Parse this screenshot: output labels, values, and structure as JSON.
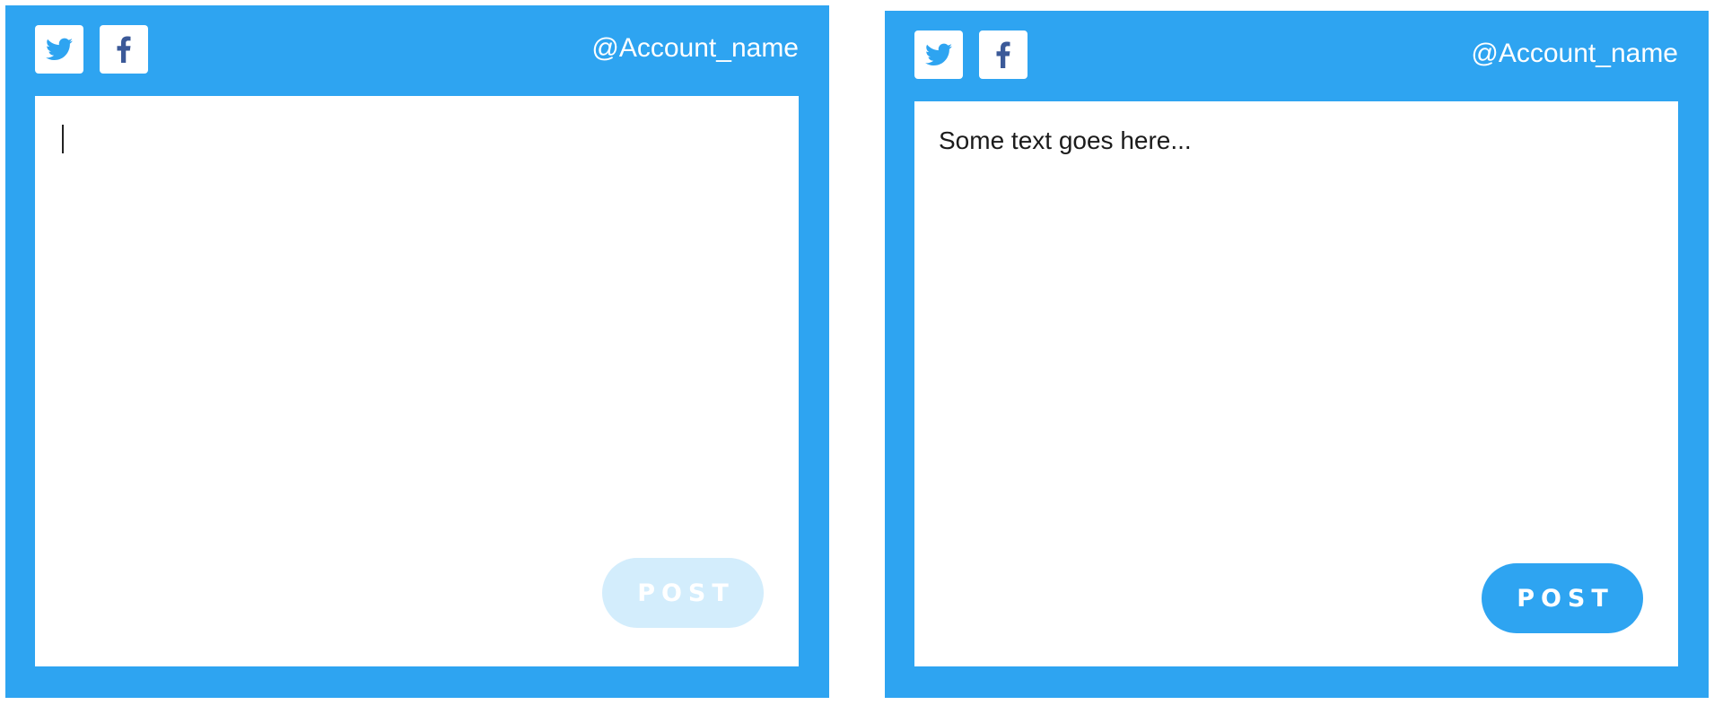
{
  "colors": {
    "brand_blue": "#2ea4f1",
    "disabled_button": "#d3edfc",
    "facebook_blue": "#3b5998",
    "twitter_blue": "#2ea4f1"
  },
  "panels": [
    {
      "state": "empty",
      "icons": [
        "twitter-icon",
        "facebook-icon"
      ],
      "account_name": "@Account_name",
      "compose_text": "",
      "post_label": "POST",
      "post_enabled": false
    },
    {
      "state": "filled",
      "icons": [
        "twitter-icon",
        "facebook-icon"
      ],
      "account_name": "@Account_name",
      "compose_text": "Some text goes here...",
      "post_label": "POST",
      "post_enabled": true
    }
  ]
}
